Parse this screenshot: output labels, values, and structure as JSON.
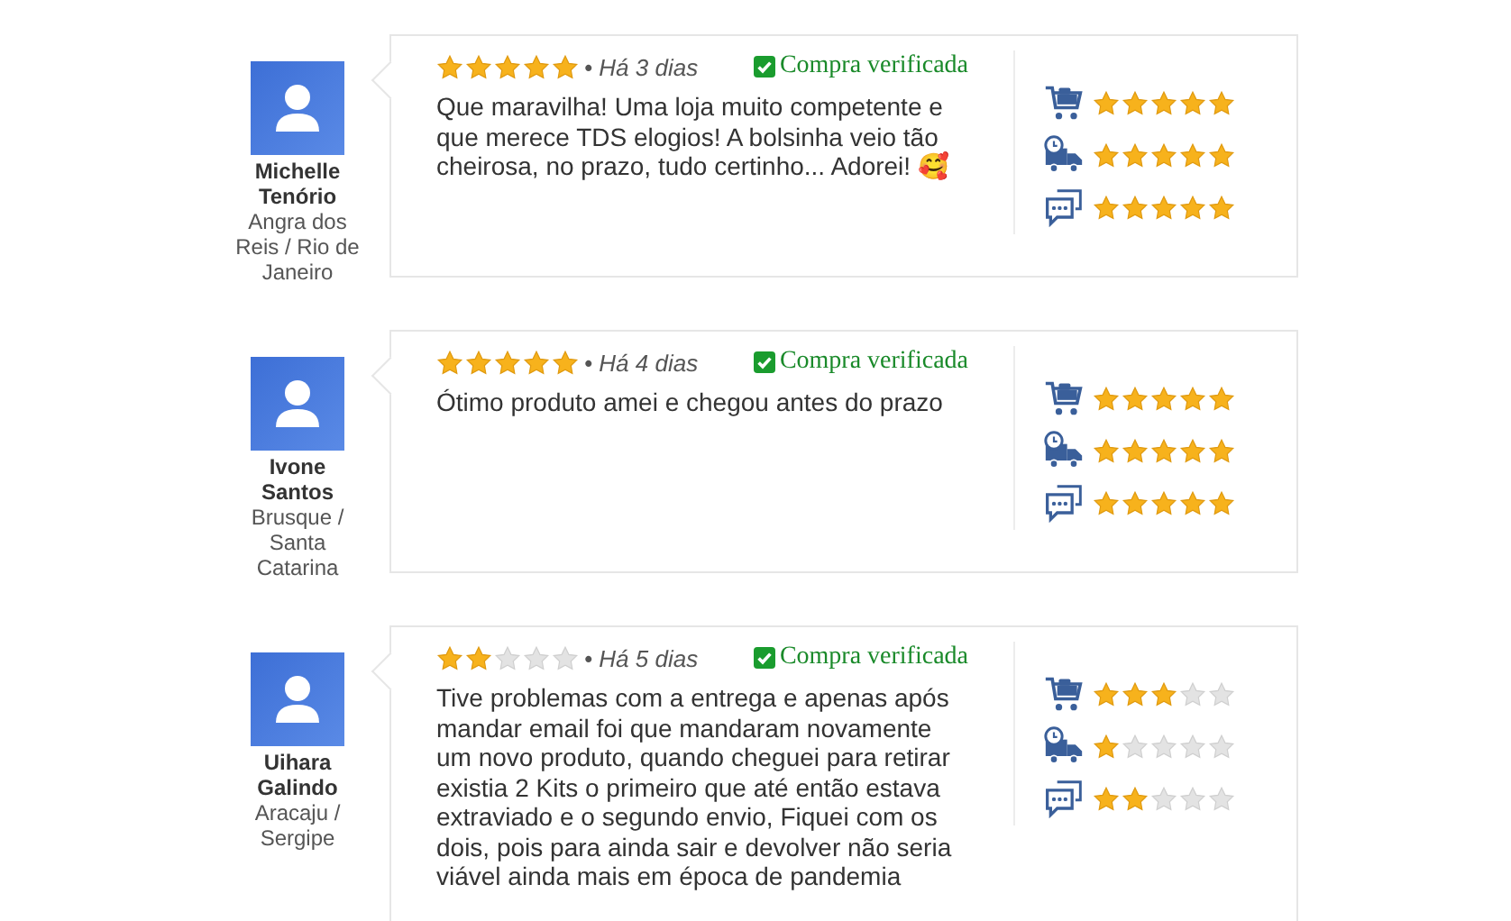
{
  "reviews": [
    {
      "author": {
        "name": "Michelle Tenório",
        "location": "Angra dos Reis / Rio de Janeiro"
      },
      "stars": 5,
      "date": "• Há 3 dias",
      "verified": "Compra verificada",
      "text": "Que maravilha! Uma loja muito competente e que merece TDS elogios! A bolsinha veio tão cheirosa, no prazo, tudo certinho... Adorei! 🥰",
      "ratings": [
        {
          "kind": "cart",
          "stars": 5
        },
        {
          "kind": "delivery",
          "stars": 5
        },
        {
          "kind": "chat",
          "stars": 5
        }
      ]
    },
    {
      "author": {
        "name": "Ivone Santos",
        "location": "Brusque / Santa Catarina"
      },
      "stars": 5,
      "date": "• Há 4 dias",
      "verified": "Compra verificada",
      "text": "Ótimo produto amei e chegou antes do prazo",
      "ratings": [
        {
          "kind": "cart",
          "stars": 5
        },
        {
          "kind": "delivery",
          "stars": 5
        },
        {
          "kind": "chat",
          "stars": 5
        }
      ]
    },
    {
      "author": {
        "name": "Uihara Galindo",
        "location": "Aracaju / Sergipe"
      },
      "stars": 2,
      "date": "• Há 5 dias",
      "verified": "Compra verificada",
      "text": "Tive problemas com a entrega e apenas após mandar email foi que mandaram novamente um novo produto, quando cheguei para retirar existia 2 Kits o primeiro que até então estava extraviado e o segundo envio, Fiquei com os dois, pois para ainda sair e devolver não seria viável ainda mais em época de pandemia",
      "ratings": [
        {
          "kind": "cart",
          "stars": 3
        },
        {
          "kind": "delivery",
          "stars": 1
        },
        {
          "kind": "chat",
          "stars": 2
        }
      ]
    }
  ]
}
